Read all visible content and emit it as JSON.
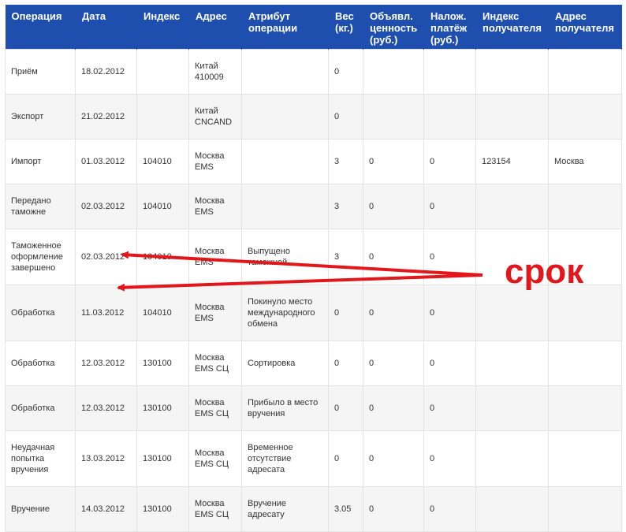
{
  "headers": [
    "Операция",
    "Дата",
    "Индекс",
    "Адрес",
    "Атрибут операции",
    "Вес (кг.)",
    "Объявл. ценность (руб.)",
    "Налож. платёж (руб.)",
    "Индекс получателя",
    "Адрес получателя"
  ],
  "rows": [
    {
      "operation": "Приём",
      "date": "18.02.2012",
      "index": "",
      "address": "Китай 410009",
      "attribute": "",
      "weight": "0",
      "declared_value": "",
      "cod": "",
      "recipient_index": "",
      "recipient_address": ""
    },
    {
      "operation": "Экспорт",
      "date": "21.02.2012",
      "index": "",
      "address": "Китай CNCAND",
      "attribute": "",
      "weight": "0",
      "declared_value": "",
      "cod": "",
      "recipient_index": "",
      "recipient_address": ""
    },
    {
      "operation": "Импорт",
      "date": "01.03.2012",
      "index": "104010",
      "address": "Москва EMS",
      "attribute": "",
      "weight": "3",
      "declared_value": "0",
      "cod": "0",
      "recipient_index": "123154",
      "recipient_address": "Москва"
    },
    {
      "operation": "Передано таможне",
      "date": "02.03.2012",
      "index": "104010",
      "address": "Москва EMS",
      "attribute": "",
      "weight": "3",
      "declared_value": "0",
      "cod": "0",
      "recipient_index": "",
      "recipient_address": ""
    },
    {
      "operation": "Таможенное оформление завершено",
      "date": "02.03.2012",
      "index": "104010",
      "address": "Москва EMS",
      "attribute": "Выпущено таможней",
      "weight": "3",
      "declared_value": "0",
      "cod": "0",
      "recipient_index": "",
      "recipient_address": ""
    },
    {
      "operation": "Обработка",
      "date": "11.03.2012",
      "index": "104010",
      "address": "Москва EMS",
      "attribute": "Покинуло место международного обмена",
      "weight": "0",
      "declared_value": "0",
      "cod": "0",
      "recipient_index": "",
      "recipient_address": ""
    },
    {
      "operation": "Обработка",
      "date": "12.03.2012",
      "index": "130100",
      "address": "Москва EMS СЦ",
      "attribute": "Сортировка",
      "weight": "0",
      "declared_value": "0",
      "cod": "0",
      "recipient_index": "",
      "recipient_address": ""
    },
    {
      "operation": "Обработка",
      "date": "12.03.2012",
      "index": "130100",
      "address": "Москва EMS СЦ",
      "attribute": "Прибыло в место вручения",
      "weight": "0",
      "declared_value": "0",
      "cod": "0",
      "recipient_index": "",
      "recipient_address": ""
    },
    {
      "operation": "Неудачная попытка вручения",
      "date": "13.03.2012",
      "index": "130100",
      "address": "Москва EMS СЦ",
      "attribute": "Временное отсутствие адресата",
      "weight": "0",
      "declared_value": "0",
      "cod": "0",
      "recipient_index": "",
      "recipient_address": ""
    },
    {
      "operation": "Вручение",
      "date": "14.03.2012",
      "index": "130100",
      "address": "Москва EMS СЦ",
      "attribute": "Вручение адресату",
      "weight": "3.05",
      "declared_value": "0",
      "cod": "0",
      "recipient_index": "",
      "recipient_address": ""
    }
  ],
  "annotation": {
    "label": "срок",
    "color": "#e2171b"
  },
  "colors": {
    "header_bg": "#1f4fae",
    "header_text": "#ffffff",
    "row_alt_bg": "#f5f5f5",
    "border": "#e3e3e3"
  }
}
